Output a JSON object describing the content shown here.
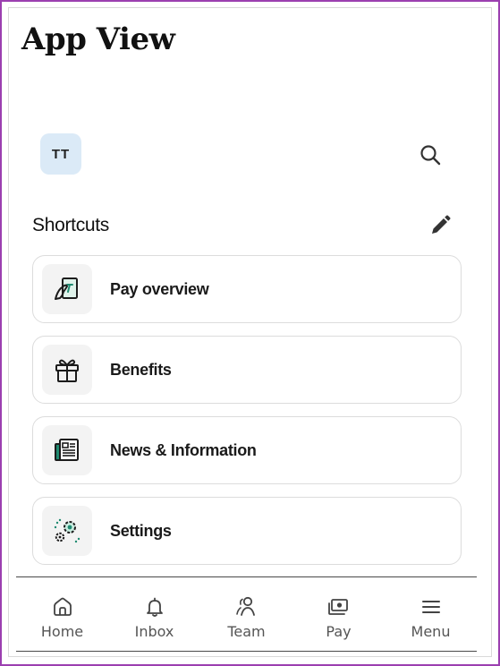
{
  "app": {
    "title": "App View"
  },
  "header": {
    "avatar_initials": "TT"
  },
  "shortcuts": {
    "title": "Shortcuts",
    "items": [
      {
        "label": "Pay overview",
        "icon": "pay-overview-icon"
      },
      {
        "label": "Benefits",
        "icon": "gift-icon"
      },
      {
        "label": "News & Information",
        "icon": "news-icon"
      },
      {
        "label": "Settings",
        "icon": "settings-icon"
      }
    ]
  },
  "nav": {
    "items": [
      {
        "label": "Home",
        "icon": "home-icon"
      },
      {
        "label": "Inbox",
        "icon": "bell-icon"
      },
      {
        "label": "Team",
        "icon": "team-icon"
      },
      {
        "label": "Pay",
        "icon": "pay-icon"
      },
      {
        "label": "Menu",
        "icon": "menu-icon"
      }
    ]
  },
  "colors": {
    "accent": "#1f8a70",
    "avatar_bg": "#dbeaf7",
    "frame_border": "#9b3fb0"
  }
}
